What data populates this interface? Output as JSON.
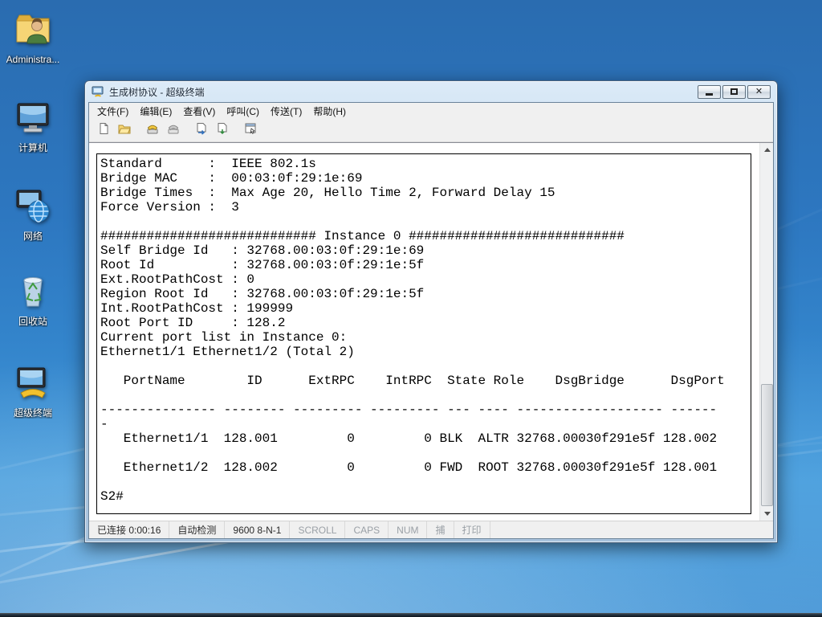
{
  "desktop": {
    "icons": [
      {
        "name": "administrator",
        "label": "Administra..."
      },
      {
        "name": "computer",
        "label": "计算机"
      },
      {
        "name": "network",
        "label": "网络"
      },
      {
        "name": "recycle-bin",
        "label": "回收站"
      },
      {
        "name": "hyperterminal",
        "label": "超级终端"
      }
    ]
  },
  "window": {
    "title": "生成树协议 - 超级终端",
    "menu": [
      "文件(F)",
      "编辑(E)",
      "查看(V)",
      "呼叫(C)",
      "传送(T)",
      "帮助(H)"
    ],
    "toolbar_icons": [
      "new-connection-icon",
      "open-icon",
      "call-icon",
      "disconnect-icon",
      "send-icon",
      "receive-icon",
      "properties-icon"
    ],
    "status": {
      "connected": "已连接 0:00:16",
      "detect": "自动检测",
      "baud": "9600 8-N-1",
      "scroll": "SCROLL",
      "caps": "CAPS",
      "num": "NUM",
      "capture": "捕",
      "print": "打印"
    }
  },
  "terminal": {
    "prompt": "S2#",
    "lines": [
      "Standard      :  IEEE 802.1s",
      "Bridge MAC    :  00:03:0f:29:1e:69",
      "Bridge Times  :  Max Age 20, Hello Time 2, Forward Delay 15",
      "Force Version :  3",
      "",
      "############################ Instance 0 ############################",
      "Self Bridge Id   : 32768.00:03:0f:29:1e:69",
      "Root Id          : 32768.00:03:0f:29:1e:5f",
      "Ext.RootPathCost : 0",
      "Region Root Id   : 32768.00:03:0f:29:1e:5f",
      "Int.RootPathCost : 199999",
      "Root Port ID     : 128.2",
      "Current port list in Instance 0:",
      "Ethernet1/1 Ethernet1/2 (Total 2)",
      "",
      "   PortName        ID      ExtRPC    IntRPC  State Role    DsgBridge      DsgPort",
      "",
      "--------------- -------- --------- --------- --- ---- ------------------- ------",
      "-",
      "   Ethernet1/1  128.001         0         0 BLK  ALTR 32768.00030f291e5f 128.002",
      "",
      "   Ethernet1/2  128.002         0         0 FWD  ROOT 32768.00030f291e5f 128.001",
      "",
      "S2#"
    ]
  },
  "colors": {
    "desktop_blue": "#2e7cc4",
    "window_chrome": "#bfd5ea",
    "terminal_bg": "#ffffff",
    "terminal_fg": "#000000"
  }
}
